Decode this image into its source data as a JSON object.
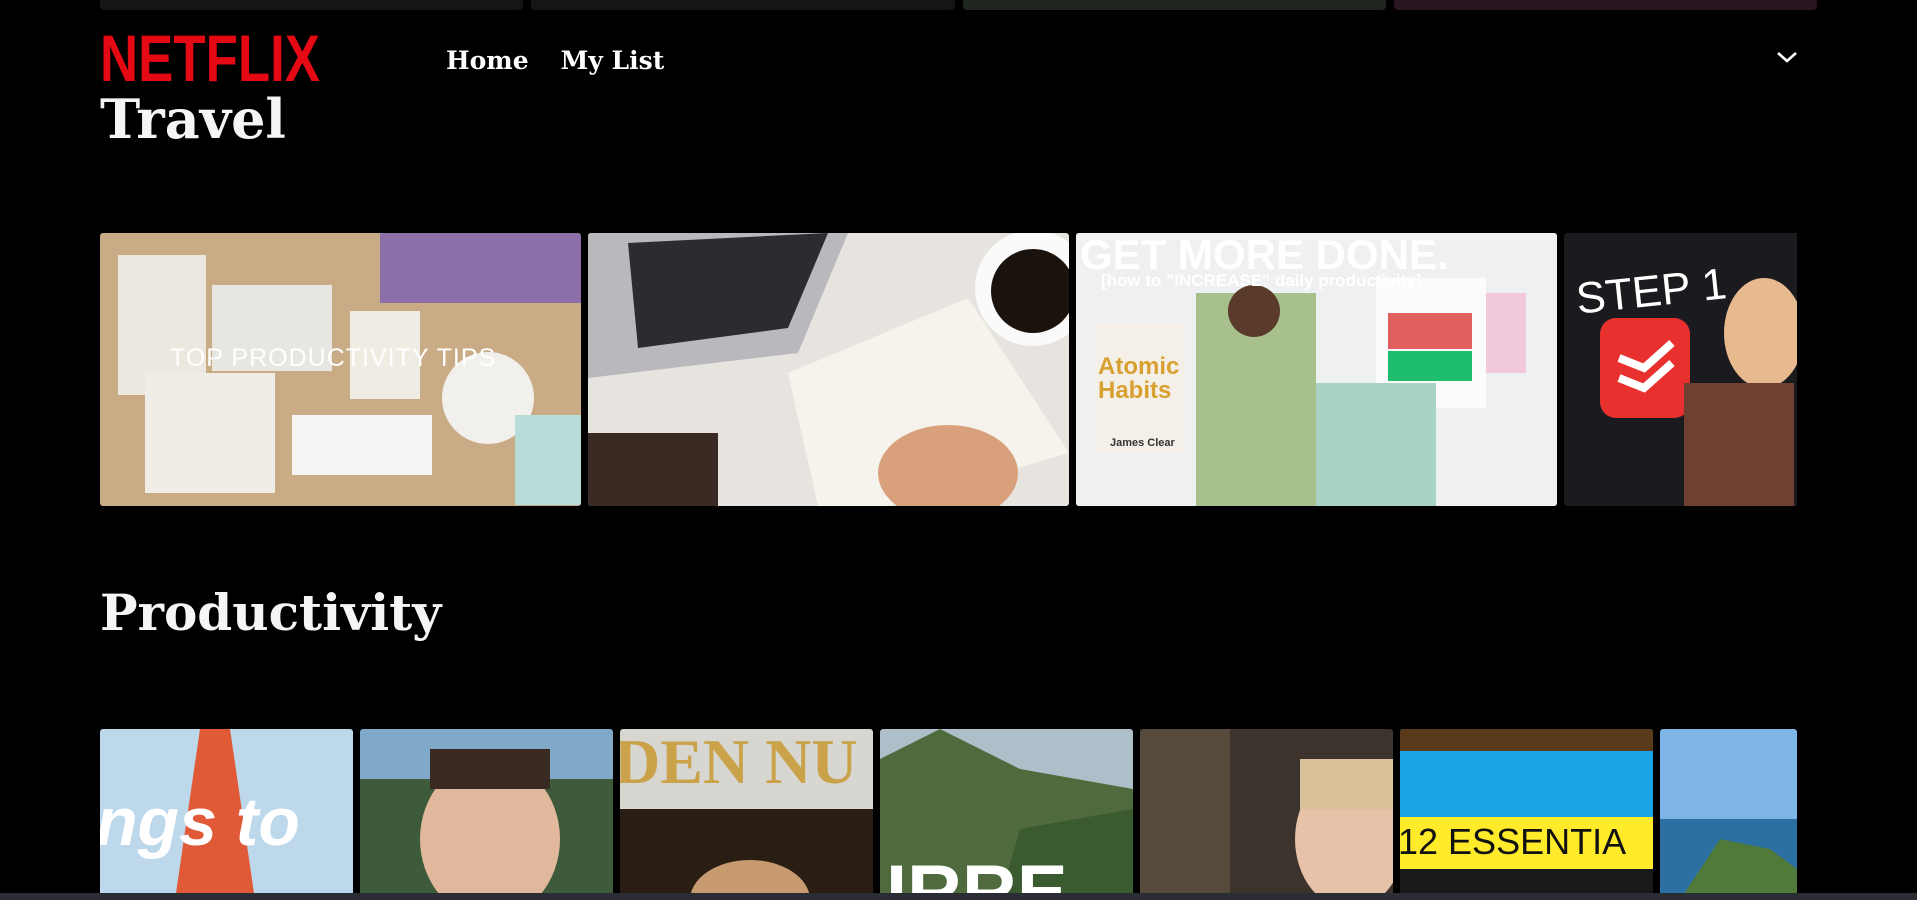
{
  "brand": {
    "logo": "NETFLIX",
    "color": "#e50914"
  },
  "nav": {
    "items": [
      {
        "label": "Home"
      },
      {
        "label": "My List"
      }
    ],
    "profile_icon": "chevron-down-icon"
  },
  "rows": [
    {
      "title": "Travel",
      "cards": [
        {
          "name": "desk-planner",
          "overlay": "TOP PRODUCTIVITY TIPS"
        },
        {
          "name": "notebook-laptop",
          "overlay": ""
        },
        {
          "name": "get-more-done",
          "headline": "GET MORE DONE.",
          "subline": "[how to \"INCREASE\" daily productivity]",
          "book_title": "Atomic Habits",
          "book_author": "James Clear"
        },
        {
          "name": "step-one",
          "overlay": "STEP 1"
        }
      ]
    },
    {
      "title": "Productivity",
      "cards": [
        {
          "name": "tokyo-tower",
          "overlay": "ngs to"
        },
        {
          "name": "man-forest",
          "overlay": ""
        },
        {
          "name": "golden-nugget",
          "overlay": "DEN NU"
        },
        {
          "name": "mountains",
          "overlay": "IRRE"
        },
        {
          "name": "woman-cave",
          "overlay": ""
        },
        {
          "name": "essentials-sky",
          "overlay": "12 ESSENTIA"
        },
        {
          "name": "coast",
          "overlay": ""
        }
      ]
    }
  ]
}
